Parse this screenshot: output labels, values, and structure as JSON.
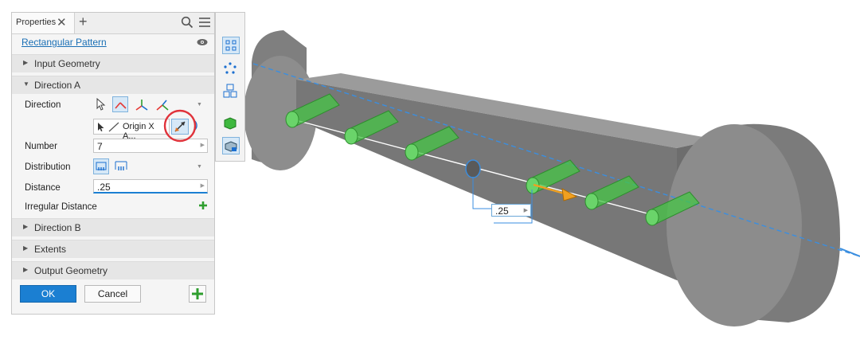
{
  "panel": {
    "tab_label": "Properties",
    "tab_close": "✕",
    "tab_add": "+",
    "feature_name": "Rectangular Pattern",
    "sections": {
      "input_geometry": "Input Geometry",
      "direction_a": "Direction A",
      "direction_b": "Direction B",
      "extents": "Extents",
      "output_geometry": "Output Geometry"
    },
    "direction_label": "Direction",
    "direction_selection": "Origin X A...",
    "number_label": "Number",
    "number_value": "7",
    "distribution_label": "Distribution",
    "distance_label": "Distance",
    "distance_value": ".25",
    "irregular_label": "Irregular Distance",
    "ok_label": "OK",
    "cancel_label": "Cancel"
  },
  "viewport": {
    "dimension_value": ".25"
  },
  "colors": {
    "accent": "#1b7fd2",
    "link": "#1a6fb5",
    "highlight_circle": "#e0323a",
    "feature_green": "#3fb83f",
    "part_gray": "#8f8f8f"
  },
  "icons": [
    "search-icon",
    "menu-icon",
    "eye-icon",
    "select-arrow-icon",
    "direction-icon",
    "flip-direction-icon",
    "add-icon",
    "fitted-distribution-icon",
    "spacing-distribution-icon"
  ]
}
